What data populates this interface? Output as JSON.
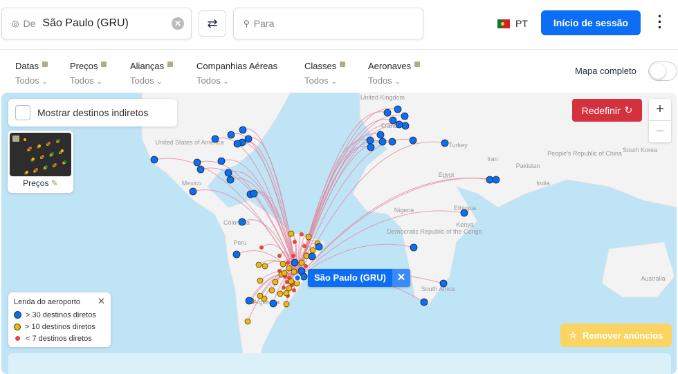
{
  "search": {
    "from_label": "De",
    "from_value": "São Paulo (GRU)",
    "to_placeholder": "Para"
  },
  "header": {
    "language": "PT",
    "login_label": "Início de sessão"
  },
  "filters": [
    {
      "label": "Datas",
      "value": "Todos",
      "locked": true
    },
    {
      "label": "Preços",
      "value": "Todos",
      "locked": true
    },
    {
      "label": "Alianças",
      "value": "Todos",
      "locked": true
    },
    {
      "label": "Companhias Aéreas",
      "value": "Todos",
      "locked": false
    },
    {
      "label": "Classes",
      "value": "Todos",
      "locked": true
    },
    {
      "label": "Aeronaves",
      "value": "Todos",
      "locked": true
    }
  ],
  "full_map_label": "Mapa completo",
  "full_map_on": false,
  "map": {
    "indirect_label": "Mostrar destinos indiretos",
    "prices_label": "Preços",
    "reset_label": "Redefinir",
    "origin_label": "São Paulo (GRU)",
    "remove_ads_label": "Remover anúncios",
    "country_labels": [
      "United States of America",
      "Mexico",
      "Colombia",
      "Peru",
      "Argentina",
      "United Kingdom",
      "France",
      "Turkey",
      "Egypt",
      "Iran",
      "Pakistan",
      "India",
      "People's Republic of China",
      "South Korea",
      "Nigeria",
      "Ethiopia",
      "Kenya",
      "Democratic Republic of the Congo",
      "South Africa",
      "Australia"
    ],
    "legend": {
      "title": "Lenda do aeroporto",
      "items": [
        {
          "label": "> 30 destinos diretos",
          "color": "#0b6ef5"
        },
        {
          "label": "> 10 destinos diretos",
          "color": "#f5b800"
        },
        {
          "label": "< 7 destinos diretos",
          "color": "#e04a3a"
        }
      ]
    }
  },
  "colors": {
    "accent": "#0b6ef5",
    "reset": "#d5303e",
    "ocean": "#bfe4f6",
    "route": "#e08aa0"
  }
}
